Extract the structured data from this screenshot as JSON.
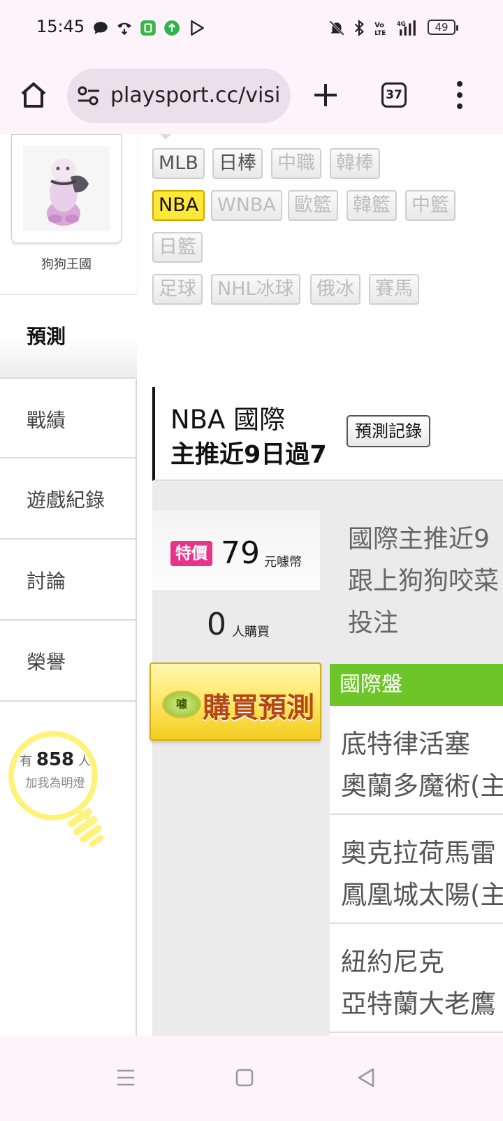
{
  "status_bar": {
    "time": "15:45",
    "icons": [
      "chat-icon",
      "call-icon",
      "app-badge-icon",
      "upload-icon",
      "play-icon",
      "mute-icon",
      "bluetooth-icon",
      "volte-icon",
      "signal-icon"
    ],
    "battery": "49"
  },
  "browser": {
    "url": "playsport.cc/visit",
    "tab_count": "37"
  },
  "sidebar": {
    "profile_name": "狗狗王國",
    "active_item": "預測",
    "items": [
      "戰績",
      "遊戲紀錄",
      "討論",
      "榮譽"
    ],
    "fans_prefix": "有",
    "fans_count": "858",
    "fans_suffix": "人",
    "fans_line2": "加我為明燈"
  },
  "sports_tags": [
    {
      "label": "MLB",
      "state": "normal"
    },
    {
      "label": "日棒",
      "state": "normal"
    },
    {
      "label": "中職",
      "state": "dim"
    },
    {
      "label": "韓棒",
      "state": "dim"
    },
    {
      "label": "NBA",
      "state": "active"
    },
    {
      "label": "WNBA",
      "state": "dim"
    },
    {
      "label": "歐籃",
      "state": "dim"
    },
    {
      "label": "韓籃",
      "state": "dim"
    },
    {
      "label": "中籃",
      "state": "dim"
    },
    {
      "label": "日籃",
      "state": "dim"
    },
    {
      "label": "足球",
      "state": "dim"
    },
    {
      "label": "NHL冰球",
      "state": "dim"
    },
    {
      "label": "俄冰",
      "state": "dim"
    },
    {
      "label": "賽馬",
      "state": "dim"
    }
  ],
  "prediction": {
    "title_line1": "NBA 國際",
    "title_line2": "主推近9日過7",
    "record_button": "預測記錄",
    "special_badge": "特價",
    "price": "79",
    "price_unit": "元噱幣",
    "buyers": "0",
    "buyers_unit": "人購買",
    "description_lines": [
      "國際主推近9",
      "跟上狗狗咬菜",
      "投注"
    ],
    "buy_coin": "噱",
    "buy_button": "購買預測",
    "table_header": "國際盤",
    "games": [
      {
        "away": "底特律活塞",
        "home": "奧蘭多魔術(主"
      },
      {
        "away": "奧克拉荷馬雷",
        "home": "鳳凰城太陽(主"
      },
      {
        "away": "紐約尼克",
        "home": "亞特蘭大老鷹"
      }
    ]
  },
  "colors": {
    "active_tag": "#ffe838",
    "special_badge": "#e8338a",
    "table_header": "#6ec52a",
    "buy_text": "#b8470e"
  }
}
